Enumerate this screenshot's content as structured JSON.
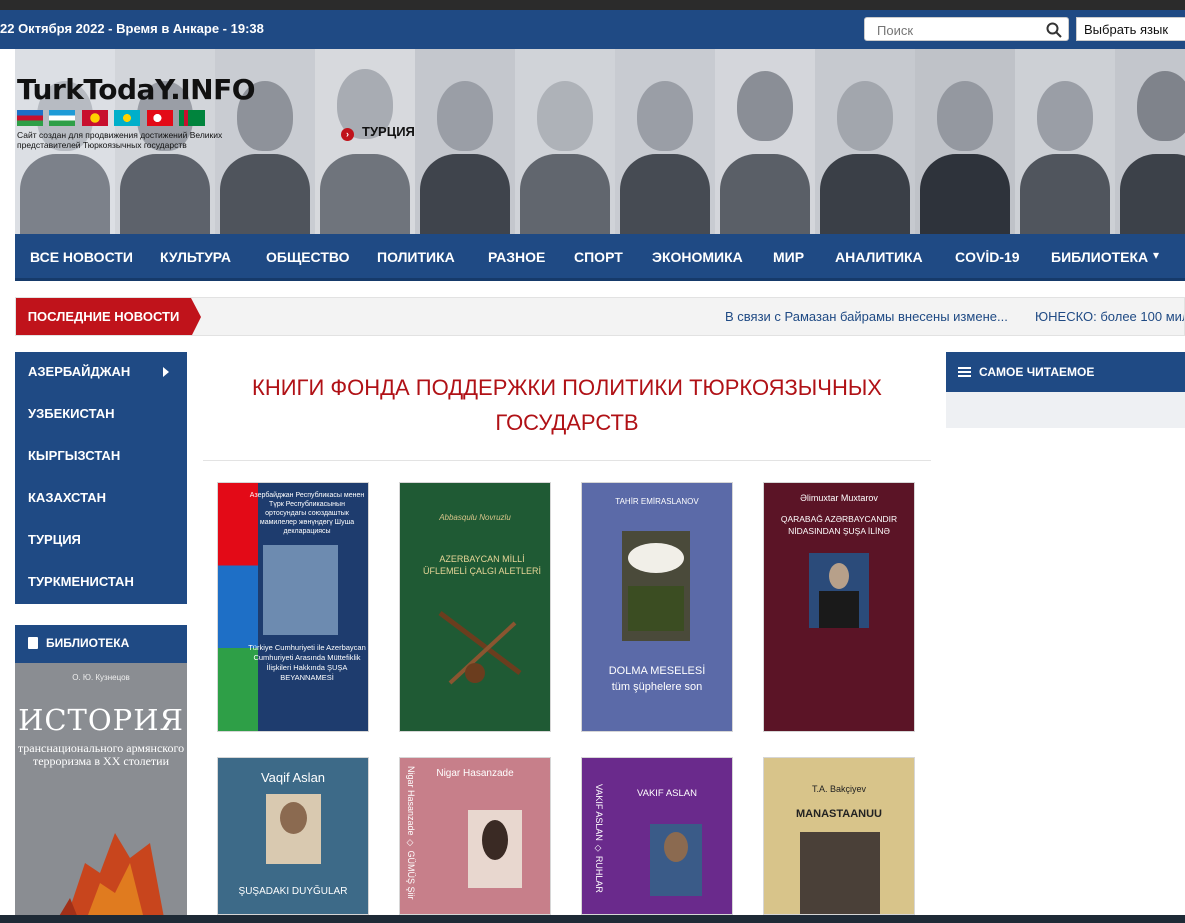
{
  "topbar": {
    "date_line": "22 Октября 2022 - Время в Анкаре - 19:38",
    "search_placeholder": "Поиск",
    "language_select": "Выбрать язык"
  },
  "header": {
    "logo_title": "TurkTodaY.INFO",
    "logo_subtitle": "Сайт создан для продвижения достижений Великих представителей Тюркоязычных государств",
    "current_country": "ТУРЦИЯ",
    "flag_colors": [
      "#1e6fc6",
      "#2e9f47",
      "#c8102e",
      "#00afca",
      "#e30a17",
      "#00843d"
    ]
  },
  "nav": {
    "items": [
      "ВСЕ НОВОСТИ",
      "КУЛЬТУРА",
      "ОБЩЕСТВО",
      "ПОЛИТИКА",
      "РАЗНОЕ",
      "СПОРТ",
      "ЭКОНОМИКА",
      "МИР",
      "АНАЛИТИКА",
      "COVİD-19",
      "БИБЛИОТЕКА"
    ],
    "dropdown_marker": "▾"
  },
  "ticker": {
    "label": "ПОСЛЕДНИЕ НОВОСТИ",
    "items": [
      "В связи с Рамазан байрамы внесены измене...",
      "ЮНЕСКО: более 100 мил"
    ]
  },
  "countries": {
    "items": [
      "АЗЕРБАЙДЖАН",
      "УЗБЕКИСТАН",
      "КЫРГЫЗСТАН",
      "КАЗАХСТАН",
      "ТУРЦИЯ",
      "ТУРКМЕНИСТАН"
    ]
  },
  "library": {
    "heading": "БИБЛИОТЕКА",
    "cover_author": "О. Ю. Кузнецов",
    "cover_title": "ИСТОРИЯ",
    "cover_subtitle": "транснационального армянского терроризма в ХХ столетии"
  },
  "main": {
    "title": "КНИГИ ФОНДА ПОДДЕРЖКИ ПОЛИТИКИ ТЮРКОЯЗЫЧНЫХ ГОСУДАРСТВ"
  },
  "books": [
    {
      "top": "Азербайджан Республикасы менен Түрк Республикасынын ортосундагы союздаштык мамилелер жөнүндөгү Шуша декларациясы",
      "bottom": "Türkiye Cumhuriyeti ile Azerbaycan Cumhuriyeti Arasında Müttefiklik İlişkileri Hakkında ŞUŞA BEYANNAMESİ",
      "bg": "#1e3c6e"
    },
    {
      "top": "AZERBAYCAN MİLLİ ÜFLEMELİ ÇALGI ALETLERİ",
      "bottom": "Abbasqulu Novruzlu",
      "bg": "#1f5a34"
    },
    {
      "top": "TAHİR EMİRASLANOV",
      "bottom": "DOLMA MESELESİ tüm şüphelere son",
      "bg": "#5b6aa8"
    },
    {
      "top": "Əlimuxtar Muxtarov",
      "bottom": "QARABAĞ AZƏRBAYCANDIR NİDASINDAN ŞUŞA İLİNƏ",
      "bg": "#5b1426"
    },
    {
      "top": "Vaqif Aslan",
      "bottom": "ŞUŞADAKI DUYĞULAR",
      "bg": "#3d6a88"
    },
    {
      "top": "Nigar Hasanzade",
      "bottom": "Nigar Hasanzade ◇ GÜMÜŞ Şiir",
      "bg": "#c77f8a"
    },
    {
      "top": "VAKIF ASLAN",
      "bottom": "VAKIF ASLAN ◇ RUHLAR",
      "bg": "#6a2a8c"
    },
    {
      "top": "T.A. Bakçiyev",
      "bottom": "MANASTAANUU",
      "bg": "#d8c48a"
    }
  ],
  "popular": {
    "heading": "САМОЕ ЧИТАЕМОЕ"
  }
}
